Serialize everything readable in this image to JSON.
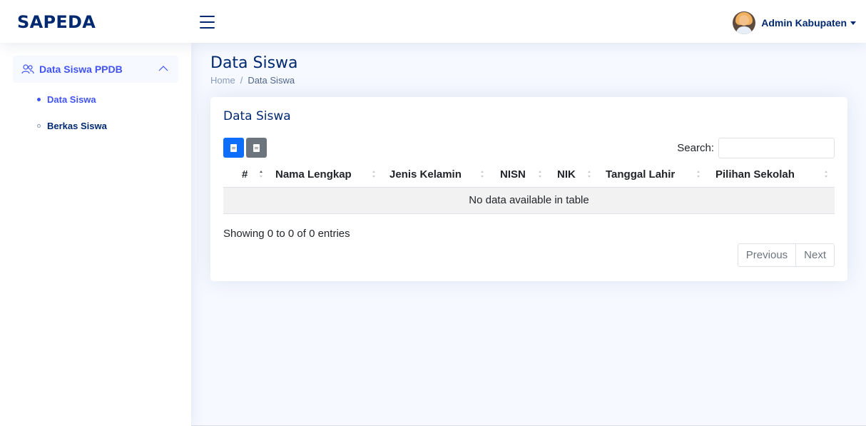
{
  "header": {
    "logo": "SAPEDA",
    "user_name": "Admin Kabupaten"
  },
  "sidebar": {
    "parent": {
      "label": "Data Siswa PPDB",
      "icon": "people-icon",
      "expanded": true
    },
    "items": [
      {
        "label": "Data Siswa",
        "active": true
      },
      {
        "label": "Berkas Siswa",
        "active": false
      }
    ]
  },
  "page": {
    "title": "Data Siswa",
    "breadcrumb": [
      "Home",
      "Data Siswa"
    ]
  },
  "card": {
    "title": "Data Siswa",
    "export_buttons": [
      {
        "name": "excel",
        "icon": "file-excel-icon",
        "color": "#0d6efd"
      },
      {
        "name": "pdf",
        "icon": "file-pdf-icon",
        "color": "#6c757d"
      }
    ],
    "search_label": "Search:",
    "search_value": "",
    "table": {
      "columns": [
        "#",
        "Nama Lengkap",
        "Jenis Kelamin",
        "NISN",
        "NIK",
        "Tanggal Lahir",
        "Pilihan Sekolah"
      ],
      "empty_text": "No data available in table"
    },
    "info": "Showing 0 to 0 of 0 entries",
    "pagination": {
      "previous": "Previous",
      "next": "Next"
    }
  },
  "colors": {
    "brand": "#012970",
    "accent": "#4154f1",
    "background": "#f6f9ff"
  }
}
